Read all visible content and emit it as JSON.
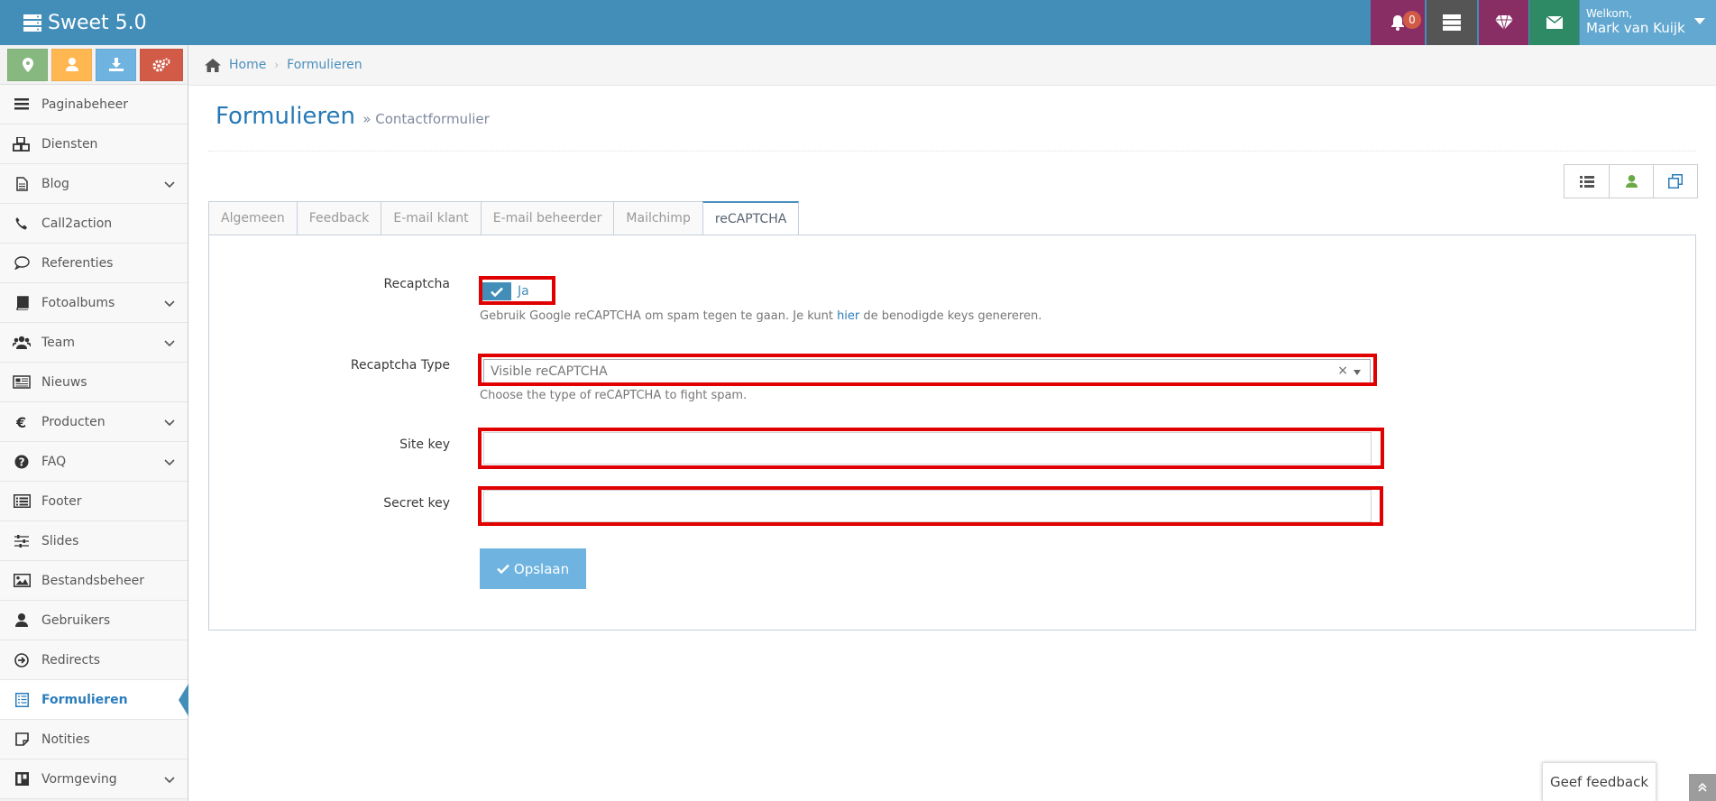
{
  "app": {
    "title": "Sweet 5.0"
  },
  "navbar": {
    "notifications_count": "0",
    "welcome_label": "Welkom,",
    "user_name": "Mark van Kuijk"
  },
  "sidebar": {
    "shortcuts": [
      {
        "icon": "map-marker-icon",
        "color": "#87b87f"
      },
      {
        "icon": "user-icon",
        "color": "#ffb752"
      },
      {
        "icon": "download-icon",
        "color": "#6fb3e0"
      },
      {
        "icon": "cogs-icon",
        "color": "#d15b47"
      }
    ],
    "items": [
      {
        "label": "Paginabeheer",
        "icon": "bars-icon",
        "submenu": false
      },
      {
        "label": "Diensten",
        "icon": "cubes-icon",
        "submenu": false
      },
      {
        "label": "Blog",
        "icon": "file-text-icon",
        "submenu": true
      },
      {
        "label": "Call2action",
        "icon": "phone-icon",
        "submenu": false
      },
      {
        "label": "Referenties",
        "icon": "comment-icon",
        "submenu": false
      },
      {
        "label": "Fotoalbums",
        "icon": "book-icon",
        "submenu": true
      },
      {
        "label": "Team",
        "icon": "users-icon",
        "submenu": true
      },
      {
        "label": "Nieuws",
        "icon": "newspaper-icon",
        "submenu": false
      },
      {
        "label": "Producten",
        "icon": "euro-icon",
        "submenu": true
      },
      {
        "label": "FAQ",
        "icon": "question-circle-icon",
        "submenu": true
      },
      {
        "label": "Footer",
        "icon": "list-alt-icon",
        "submenu": false
      },
      {
        "label": "Slides",
        "icon": "sliders-icon",
        "submenu": false
      },
      {
        "label": "Bestandsbeheer",
        "icon": "image-icon",
        "submenu": false
      },
      {
        "label": "Gebruikers",
        "icon": "user-icon",
        "submenu": false
      },
      {
        "label": "Redirects",
        "icon": "arrow-circle-right-icon",
        "submenu": false
      },
      {
        "label": "Formulieren",
        "icon": "form-icon",
        "submenu": false,
        "active": true
      },
      {
        "label": "Notities",
        "icon": "sticky-note-icon",
        "submenu": false
      },
      {
        "label": "Vormgeving",
        "icon": "layout-icon",
        "submenu": true
      }
    ]
  },
  "breadcrumb": {
    "home": "Home",
    "current": "Formulieren"
  },
  "page": {
    "title": "Formulieren",
    "subtitle": "» Contactformulier"
  },
  "tabs": [
    {
      "label": "Algemeen"
    },
    {
      "label": "Feedback"
    },
    {
      "label": "E-mail klant"
    },
    {
      "label": "E-mail beheerder"
    },
    {
      "label": "Mailchimp"
    },
    {
      "label": "reCAPTCHA",
      "active": true
    }
  ],
  "form": {
    "recaptcha": {
      "label": "Recaptcha",
      "toggle_value": "Ja",
      "help_before": "Gebruik Google reCAPTCHA om spam tegen te gaan. Je kunt ",
      "help_link": "hier",
      "help_after": " de benodigde keys genereren."
    },
    "recaptcha_type": {
      "label": "Recaptcha Type",
      "selected": "Visible reCAPTCHA",
      "help": "Choose the type of reCAPTCHA to fight spam."
    },
    "site_key": {
      "label": "Site key",
      "value": ""
    },
    "secret_key": {
      "label": "Secret key",
      "value": ""
    },
    "save_label": "Opslaan"
  },
  "feedback_label": "Geef feedback",
  "colors": {
    "navbar": "#438eb9",
    "highlight": "#e00000",
    "accent": "#2b7dbc"
  }
}
